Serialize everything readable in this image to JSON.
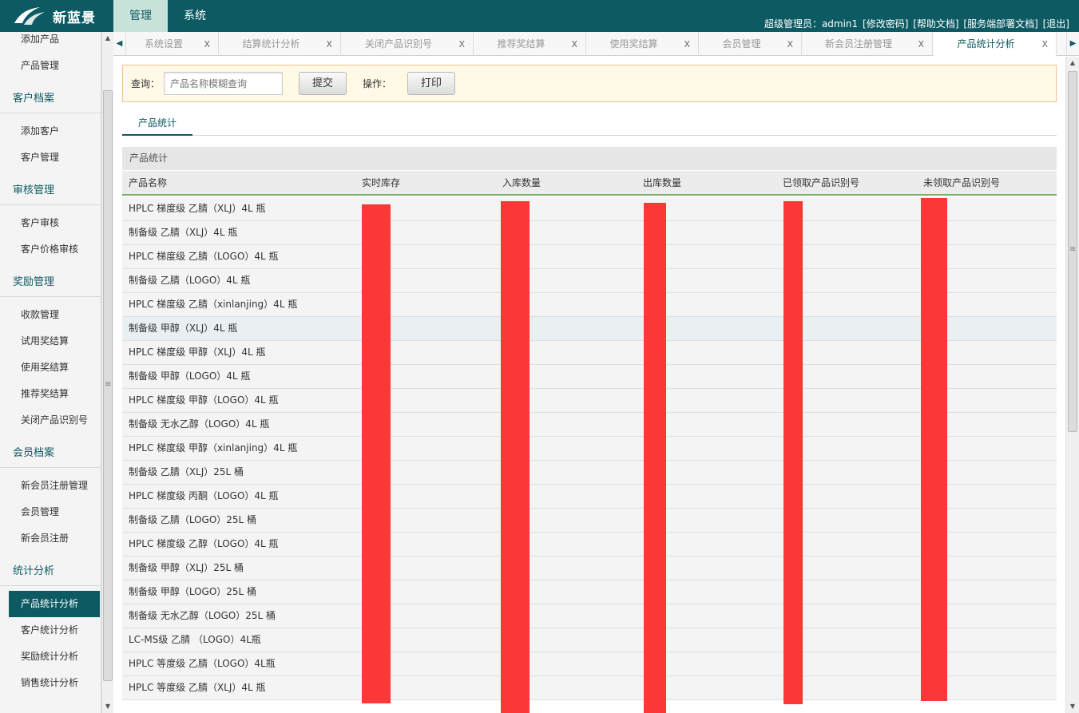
{
  "header": {
    "brand": "新蓝景",
    "top_tabs": [
      "管理",
      "系统"
    ],
    "user_label": "超级管理员：admin1",
    "links": [
      "[修改密码]",
      "[帮助文档]",
      "[服务端部署文档]",
      "[退出]"
    ]
  },
  "sidebar": {
    "items": [
      {
        "label": "添加产品"
      },
      {
        "label": "产品管理"
      },
      {
        "label": "客户档案",
        "heading": true
      },
      {
        "label": "添加客户"
      },
      {
        "label": "客户管理"
      },
      {
        "label": "审核管理",
        "heading": true
      },
      {
        "label": "客户审核"
      },
      {
        "label": "客户价格审核"
      },
      {
        "label": "奖励管理",
        "heading": true
      },
      {
        "label": "收款管理"
      },
      {
        "label": "试用奖结算"
      },
      {
        "label": "使用奖结算"
      },
      {
        "label": "推荐奖结算"
      },
      {
        "label": "关闭产品识别号"
      },
      {
        "label": "会员档案",
        "heading": true
      },
      {
        "label": "新会员注册管理"
      },
      {
        "label": "会员管理"
      },
      {
        "label": "新会员注册"
      },
      {
        "label": "统计分析",
        "heading": true
      },
      {
        "label": "产品统计分析",
        "active": true
      },
      {
        "label": "客户统计分析"
      },
      {
        "label": "奖励统计分析"
      },
      {
        "label": "销售统计分析"
      }
    ]
  },
  "tabs": {
    "items": [
      {
        "label": "系统设置",
        "close": "X"
      },
      {
        "label": "结算统计分析",
        "close": "X"
      },
      {
        "label": "关闭产品识别号",
        "close": "X"
      },
      {
        "label": "推荐奖结算",
        "close": "X"
      },
      {
        "label": "使用奖结算",
        "close": "X"
      },
      {
        "label": "会员管理",
        "close": "X"
      },
      {
        "label": "新会员注册管理",
        "close": "X"
      },
      {
        "label": "产品统计分析",
        "close": "X",
        "active": true
      }
    ]
  },
  "search": {
    "query_label": "查询：",
    "placeholder": "产品名称模糊查询",
    "submit_label": "提交",
    "ops_label": "操作：",
    "print_label": "打印"
  },
  "inner_tab": "产品统计",
  "table": {
    "caption": "产品统计",
    "columns": [
      "产品名称",
      "实时库存",
      "入库数量",
      "出库数量",
      "已领取产品识别号",
      "未领取产品识别号"
    ],
    "rows": [
      "HPLC 梯度级 乙腈（XLJ）4L 瓶",
      "制备级 乙腈（XLJ）4L 瓶",
      "HPLC 梯度级 乙腈（LOGO）4L 瓶",
      "制备级 乙腈（LOGO）4L 瓶",
      "HPLC 梯度级 乙腈（xinlanjing）4L 瓶",
      "制备级 甲醇（XLJ）4L 瓶",
      "HPLC 梯度级 甲醇（XLJ）4L 瓶",
      "制备级 甲醇（LOGO）4L 瓶",
      "HPLC 梯度级 甲醇（LOGO）4L 瓶",
      "制备级 无水乙醇（LOGO）4L 瓶",
      "HPLC 梯度级 甲醇（xinlanjing）4L 瓶",
      "制备级 乙腈（XLJ）25L 桶",
      "HPLC 梯度级 丙酮（LOGO）4L 瓶",
      "制备级 乙腈（LOGO）25L 桶",
      "HPLC 梯度级 乙醇（LOGO）4L 瓶",
      "制备级 甲醇（XLJ）25L 桶",
      "制备级 甲醇（LOGO）25L 桶",
      "制备级 无水乙醇（LOGO）25L 桶",
      "LC-MS级 乙腈 （LOGO）4L瓶",
      "HPLC 等度级 乙腈（LOGO）4L瓶",
      "HPLC 等度级 乙腈（XLJ）4L 瓶"
    ],
    "highlight_row": 5
  },
  "colors": {
    "primary": "#0d5a63",
    "redaction": "#fa3838",
    "search_bg": "#fff9e6",
    "search_border": "#f1c38c",
    "header_underline": "#77b26a"
  }
}
